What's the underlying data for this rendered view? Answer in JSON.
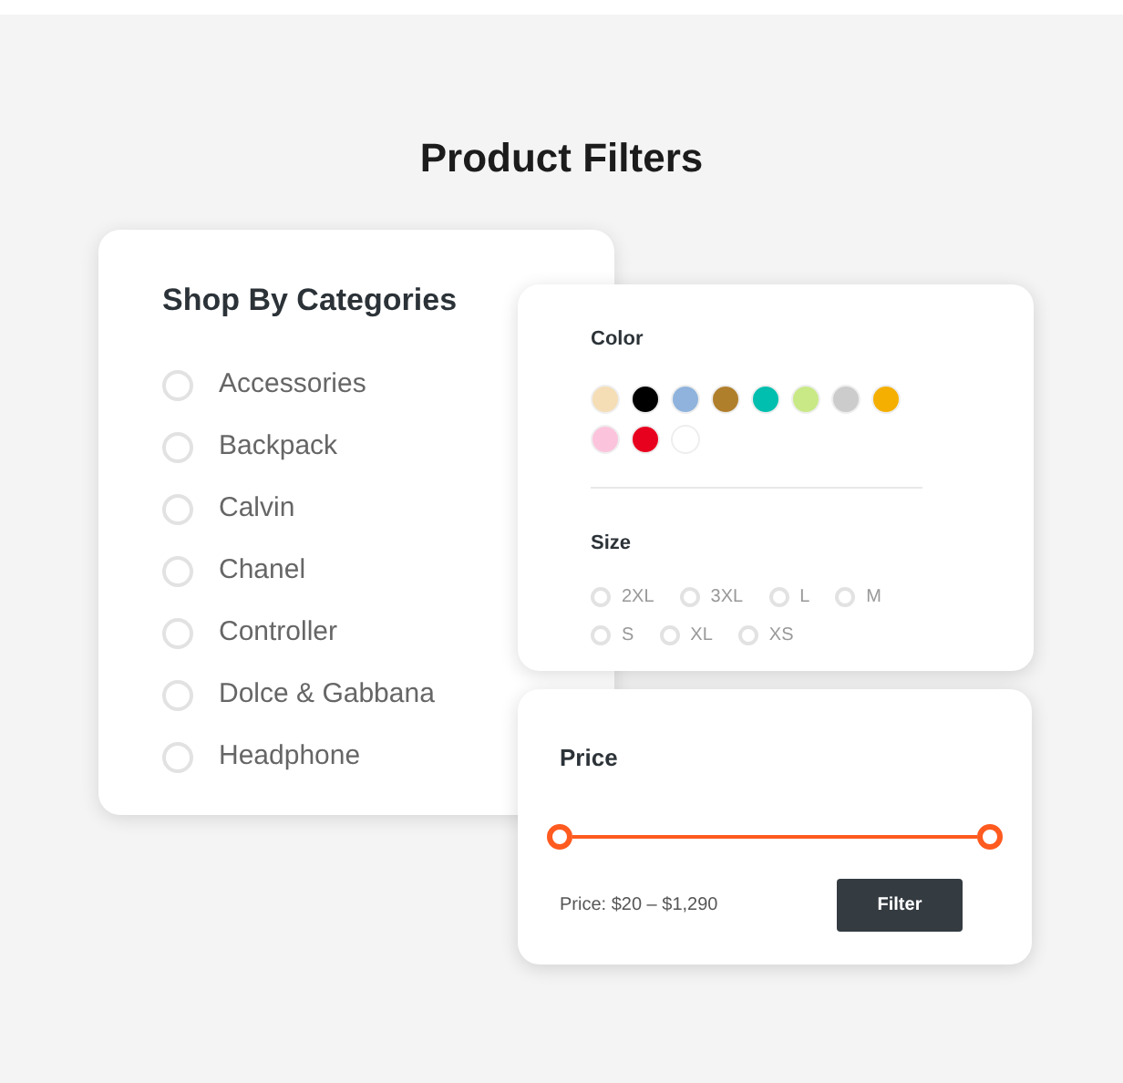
{
  "title": "Product Filters",
  "categories": {
    "heading": "Shop By Categories",
    "items": [
      {
        "label": "Accessories",
        "selected": false
      },
      {
        "label": "Backpack",
        "selected": false
      },
      {
        "label": "Calvin",
        "selected": false
      },
      {
        "label": "Chanel",
        "selected": false
      },
      {
        "label": "Controller",
        "selected": false
      },
      {
        "label": "Dolce & Gabbana",
        "selected": false
      },
      {
        "label": "Headphone",
        "selected": false
      }
    ]
  },
  "color": {
    "heading": "Color",
    "swatches": [
      {
        "color": "#f5ddb5"
      },
      {
        "color": "#000000"
      },
      {
        "color": "#8fb3dc"
      },
      {
        "color": "#b07f2c"
      },
      {
        "color": "#00bfae"
      },
      {
        "color": "#c8e986"
      },
      {
        "color": "#cccccc"
      },
      {
        "color": "#f4af00"
      },
      {
        "color": "#fcc4dc"
      },
      {
        "color": "#e8001f"
      },
      {
        "color": "#ffffff"
      }
    ]
  },
  "size": {
    "heading": "Size",
    "options": [
      {
        "label": "2XL",
        "selected": false
      },
      {
        "label": "3XL",
        "selected": false
      },
      {
        "label": "L",
        "selected": false
      },
      {
        "label": "M",
        "selected": false
      },
      {
        "label": "S",
        "selected": false
      },
      {
        "label": "XL",
        "selected": false
      },
      {
        "label": "XS",
        "selected": false
      }
    ]
  },
  "price": {
    "heading": "Price",
    "slider": {
      "level": 1
    },
    "reading": "Price: $20 – $1,290",
    "button": "Filter"
  }
}
